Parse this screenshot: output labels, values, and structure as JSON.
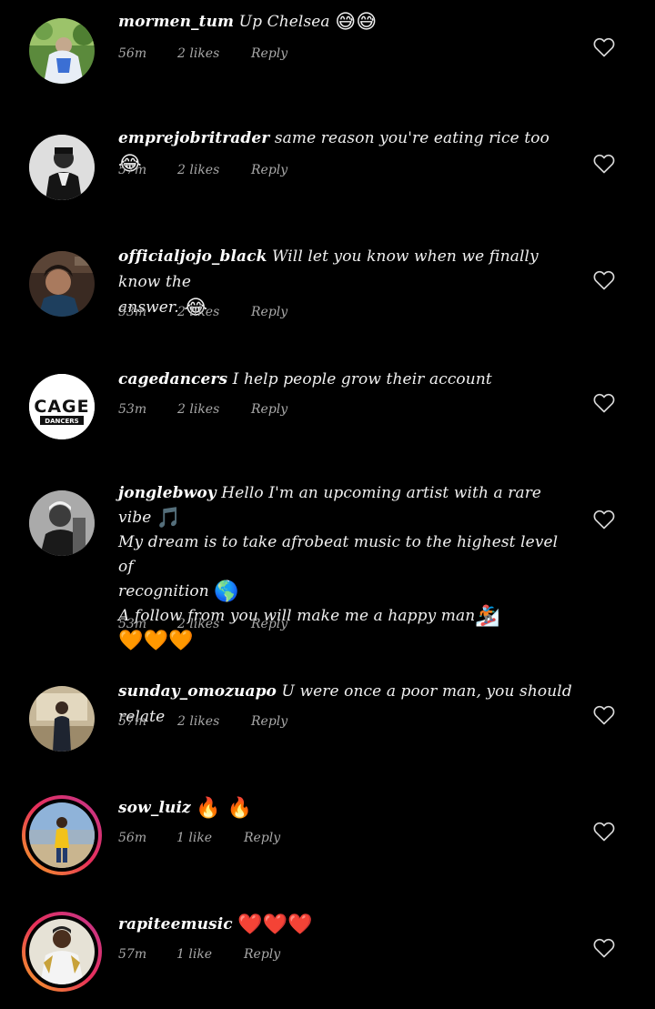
{
  "comments": [
    {
      "username": "mormen_tum",
      "text": "Up Chelsea",
      "emoji": "😅😅",
      "time": "56m",
      "likes": "2 likes",
      "reply": "Reply"
    },
    {
      "username": "emprejobritrader",
      "text": "same reason you're eating rice too",
      "emoji": "😂",
      "time": "57m",
      "likes": "2 likes",
      "reply": "Reply"
    },
    {
      "username": "officialjojo_black",
      "text": "Will let you know when we finally know the",
      "text2": "answer.",
      "emoji": "😂",
      "time": "53m",
      "likes": "2 likes",
      "reply": "Reply"
    },
    {
      "username": "cagedancers",
      "text": "I help people grow their account",
      "time": "53m",
      "likes": "2 likes",
      "reply": "Reply",
      "avatar_text_top": "CAGE",
      "avatar_text_bottom": "DANCERS"
    },
    {
      "username": "jonglebwoy",
      "text": "Hello I'm an upcoming artist with a rare vibe",
      "emoji": "🎵",
      "text2": "My dream is to take afrobeat music to the highest level of",
      "text3": "recognition",
      "emoji3": "🌎",
      "text4": "A follow from you will make me a happy man",
      "emoji4": "🏂",
      "emoji5": "🧡🧡🧡",
      "time": "53m",
      "likes": "2 likes",
      "reply": "Reply"
    },
    {
      "username": "sunday_omozuapo",
      "text": "U were once a poor man,  you should relate",
      "time": "57m",
      "likes": "2 likes",
      "reply": "Reply"
    },
    {
      "username": "sow_luiz",
      "text": "",
      "emoji": "🔥 🔥",
      "time": "56m",
      "likes": "1 like",
      "reply": "Reply"
    },
    {
      "username": "rapiteemusic",
      "text": "",
      "emoji": "❤️❤️❤️",
      "time": "57m",
      "likes": "1 like",
      "reply": "Reply"
    }
  ],
  "colors": {
    "background": "#000000",
    "text": "#f0f0f0",
    "meta": "#a8a8a8",
    "story_ring_start": "#f5a623",
    "story_ring_end": "#c1358f"
  },
  "icons": {
    "like": "heart-outline-icon"
  }
}
